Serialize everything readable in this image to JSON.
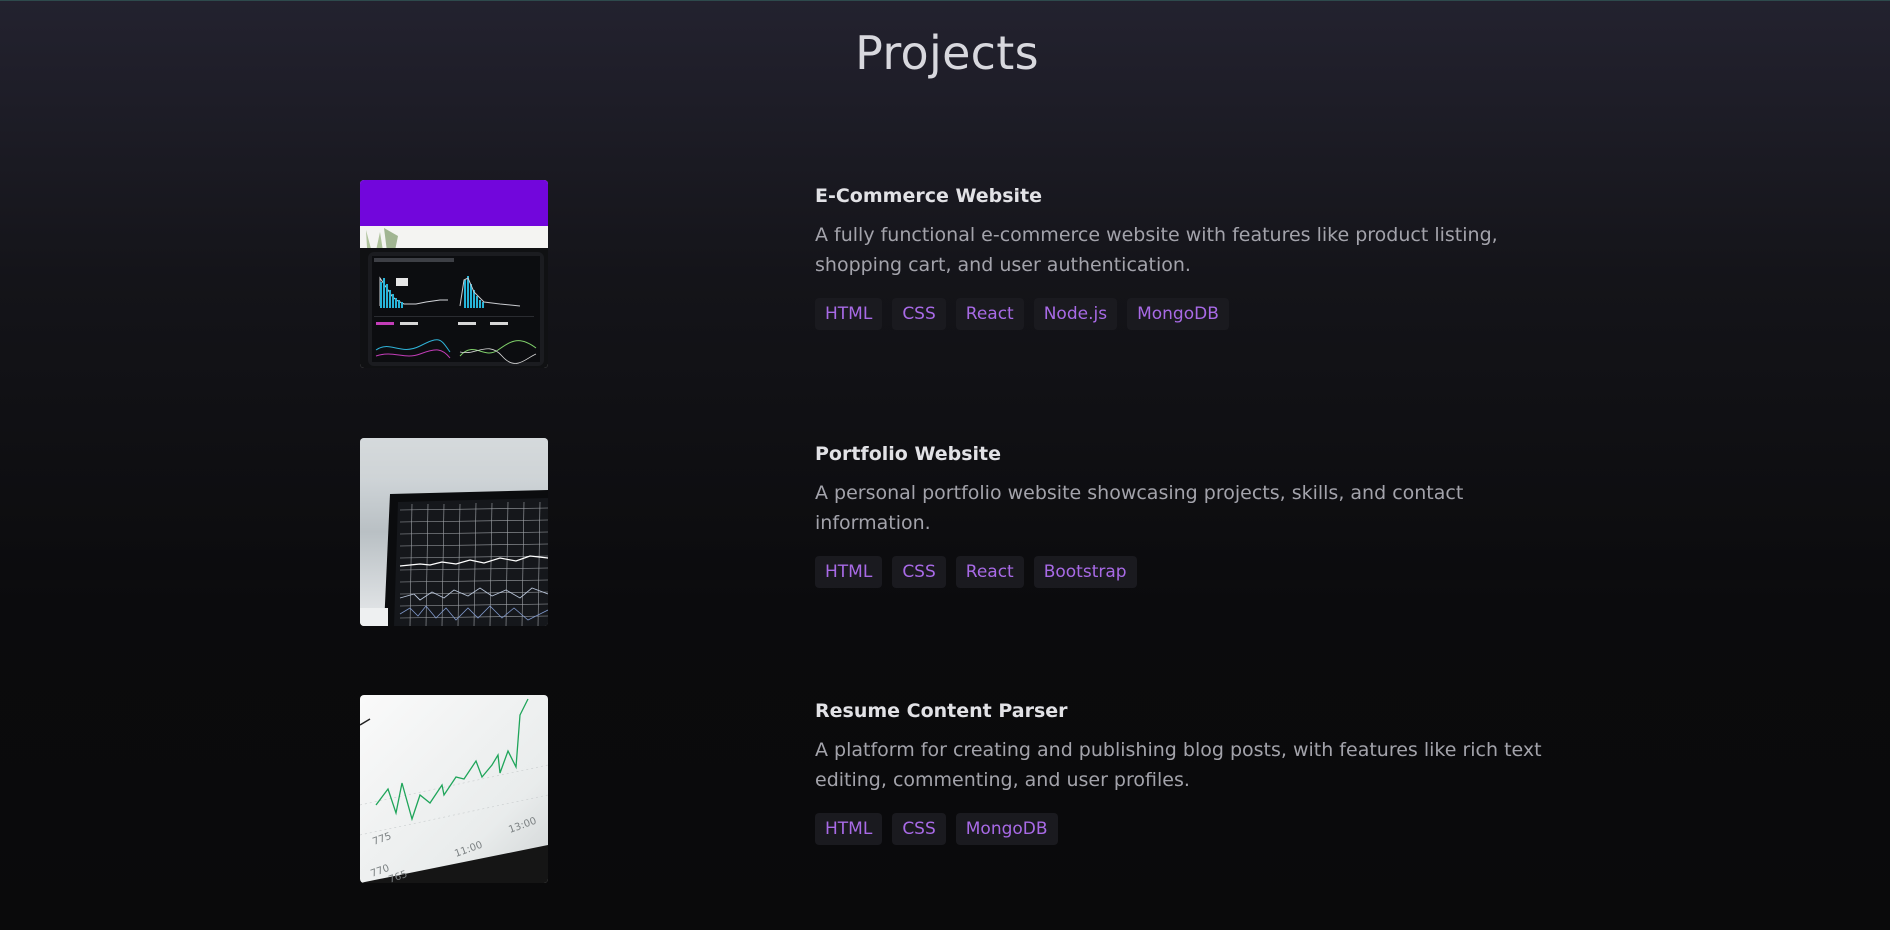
{
  "page": {
    "title": "Projects"
  },
  "colors": {
    "tag_text": "#a86ae6",
    "tag_bg": "#1a1a1f",
    "background_top": "#23222f",
    "background_bottom": "#0a0a0b"
  },
  "projects": [
    {
      "title": "E-Commerce Website",
      "description": "A fully functional e-commerce website with features like product listing, shopping cart, and user authentication.",
      "tags": [
        "HTML",
        "CSS",
        "React",
        "Node.js",
        "MongoDB"
      ],
      "image": "dashboard-tablet-image"
    },
    {
      "title": "Portfolio Website",
      "description": "A personal portfolio website showcasing projects, skills, and contact information.",
      "tags": [
        "HTML",
        "CSS",
        "React",
        "Bootstrap"
      ],
      "image": "laptop-chart-image"
    },
    {
      "title": "Resume Content Parser",
      "description": "A platform for creating and publishing blog posts, with features like rich text editing, commenting, and user profiles.",
      "tags": [
        "HTML",
        "CSS",
        "MongoDB"
      ],
      "image": "printed-line-chart-image"
    }
  ]
}
